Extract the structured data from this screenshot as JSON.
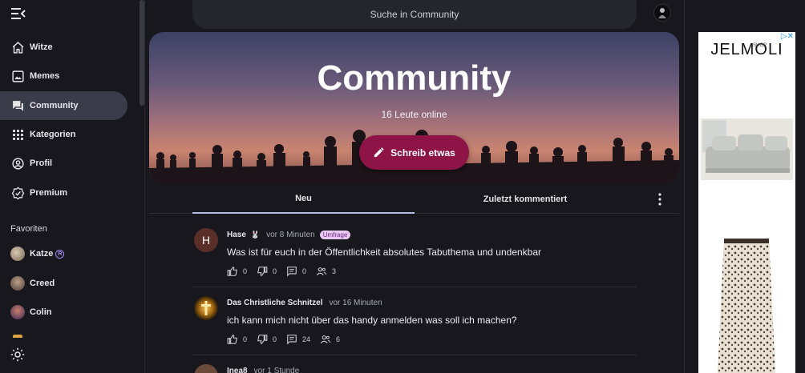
{
  "sidebar": {
    "menu_icon": "hamburger-menu-icon",
    "items": [
      {
        "label": "Witze",
        "icon": "home-icon",
        "active": false
      },
      {
        "label": "Memes",
        "icon": "image-icon",
        "active": false
      },
      {
        "label": "Community",
        "icon": "forum-icon",
        "active": true
      },
      {
        "label": "Kategorien",
        "icon": "grid-icon",
        "active": false
      },
      {
        "label": "Profil",
        "icon": "account-icon",
        "active": false
      },
      {
        "label": "Premium",
        "icon": "verified-badge-icon",
        "active": false
      }
    ],
    "favorites_title": "Favoriten",
    "favorites": [
      {
        "label": "Katze"
      },
      {
        "label": "Creed"
      },
      {
        "label": "Colin"
      }
    ],
    "theme_icon": "sun-icon"
  },
  "header": {
    "search_placeholder": "Suche in Community"
  },
  "hero": {
    "title": "Community",
    "online": "16 Leute online",
    "write_button": "Schreib etwas"
  },
  "tabs": [
    {
      "label": "Neu",
      "active": true
    },
    {
      "label": "Zuletzt kommentiert",
      "active": false
    }
  ],
  "posts": [
    {
      "avatar_letter": "H",
      "author": "Hase",
      "author_emoji": "🐰",
      "time": "vor 8 Minuten",
      "badge": "Umfrage",
      "text": "Was ist für euch in der Öffentlichkeit absolutes Tabuthema und undenkbar",
      "likes": "0",
      "dislikes": "0",
      "comments": "0",
      "participants": "3"
    },
    {
      "avatar_letter": "",
      "author": "Das Christliche Schnitzel",
      "time": "vor 16 Minuten",
      "text": "ich kann mich nicht über das handy anmelden was soll ich machen?",
      "likes": "0",
      "dislikes": "0",
      "comments": "24",
      "participants": "6"
    },
    {
      "avatar_letter": "",
      "author": "Inea8",
      "time": "vor 1 Stunde"
    }
  ],
  "ad": {
    "brand": "JELMOLI",
    "shop": "SHOP",
    "choice": "▷✕"
  },
  "colors": {
    "active_nav": "#3b3c4a",
    "write_button": "#8e1448",
    "tab_underline": "#b7bce6",
    "badge_bg": "#e9c9f2"
  }
}
